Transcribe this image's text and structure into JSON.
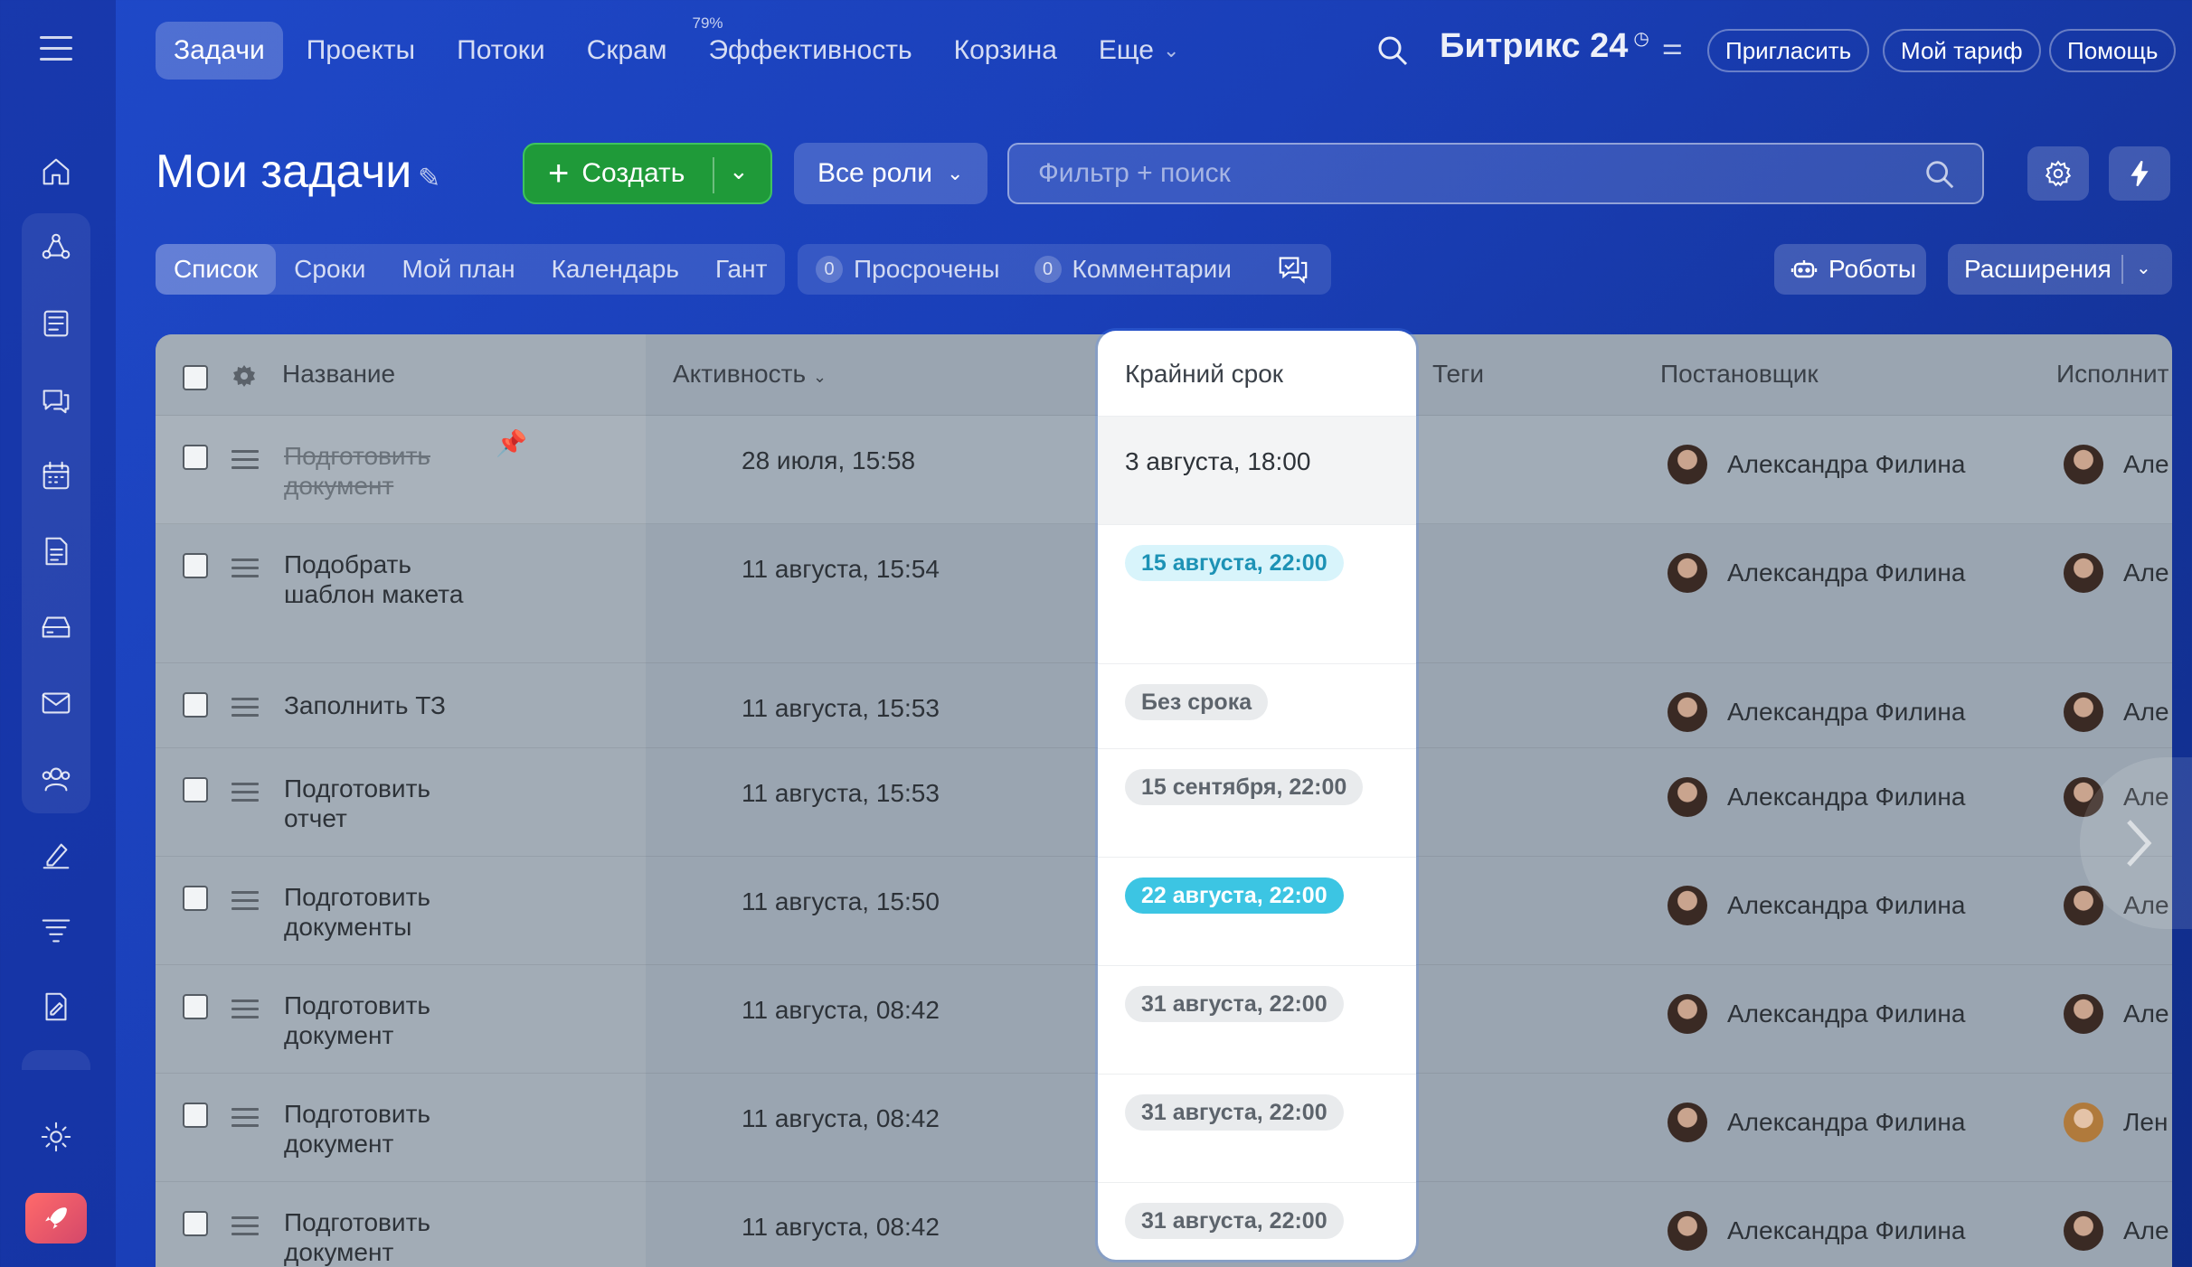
{
  "topnav": {
    "tabs": [
      {
        "label": "Задачи",
        "active": true
      },
      {
        "label": "Проекты"
      },
      {
        "label": "Потоки"
      },
      {
        "label": "Скрам"
      },
      {
        "label": "Эффективность",
        "sup": "79%"
      },
      {
        "label": "Корзина"
      },
      {
        "label": "Еще"
      }
    ],
    "brand": "Битрикс 24",
    "invite": "Пригласить",
    "tariff": "Мой тариф",
    "help": "Помощь"
  },
  "header": {
    "title": "Мои задачи",
    "create": "Создать",
    "roles": "Все роли",
    "filter_placeholder": "Фильтр + поиск"
  },
  "views": {
    "tabs": [
      "Список",
      "Сроки",
      "Мой план",
      "Календарь",
      "Гант"
    ],
    "overdue_count": "0",
    "overdue_label": "Просрочены",
    "comments_count": "0",
    "comments_label": "Комментарии",
    "robots": "Роботы",
    "extensions": "Расширения"
  },
  "table": {
    "columns": {
      "name": "Название",
      "activity": "Активность",
      "deadline": "Крайний срок",
      "tags": "Теги",
      "author": "Постановщик",
      "executor": "Исполнит"
    },
    "rows": [
      {
        "title": "Подготовить документ",
        "done": true,
        "activity": "28 июля, 15:58",
        "deadline": "3 августа, 18:00",
        "deadline_style": "plain",
        "author": "Александра Филина",
        "executor": "Але"
      },
      {
        "title": "Подобрать шаблон макета",
        "activity": "11 августа, 15:54",
        "deadline": "15 августа, 22:00",
        "deadline_style": "soft",
        "author": "Александра Филина",
        "executor": "Але"
      },
      {
        "title": "Заполнить ТЗ",
        "activity": "11 августа, 15:53",
        "deadline": "Без срока",
        "deadline_style": "gray",
        "author": "Александра Филина",
        "executor": "Але"
      },
      {
        "title": "Подготовить отчет",
        "activity": "11 августа, 15:53",
        "deadline": "15 сентября, 22:00",
        "deadline_style": "gray",
        "author": "Александра Филина",
        "executor": "Але"
      },
      {
        "title": "Подготовить документы",
        "activity": "11 августа, 15:50",
        "deadline": "22 августа, 22:00",
        "deadline_style": "strong",
        "author": "Александра Филина",
        "executor": "Але"
      },
      {
        "title": "Подготовить документ",
        "activity": "11 августа, 08:42",
        "deadline": "31 августа, 22:00",
        "deadline_style": "gray",
        "author": "Александра Филина",
        "executor": "Але"
      },
      {
        "title": "Подготовить документ",
        "activity": "11 августа, 08:42",
        "deadline": "31 августа, 22:00",
        "deadline_style": "gray",
        "author": "Александра Филина",
        "executor": "Лен"
      },
      {
        "title": "Подготовить документ",
        "activity": "11 августа, 08:42",
        "deadline": "31 августа, 22:00",
        "deadline_style": "gray",
        "author": "Александра Филина",
        "executor": "Але"
      }
    ]
  }
}
